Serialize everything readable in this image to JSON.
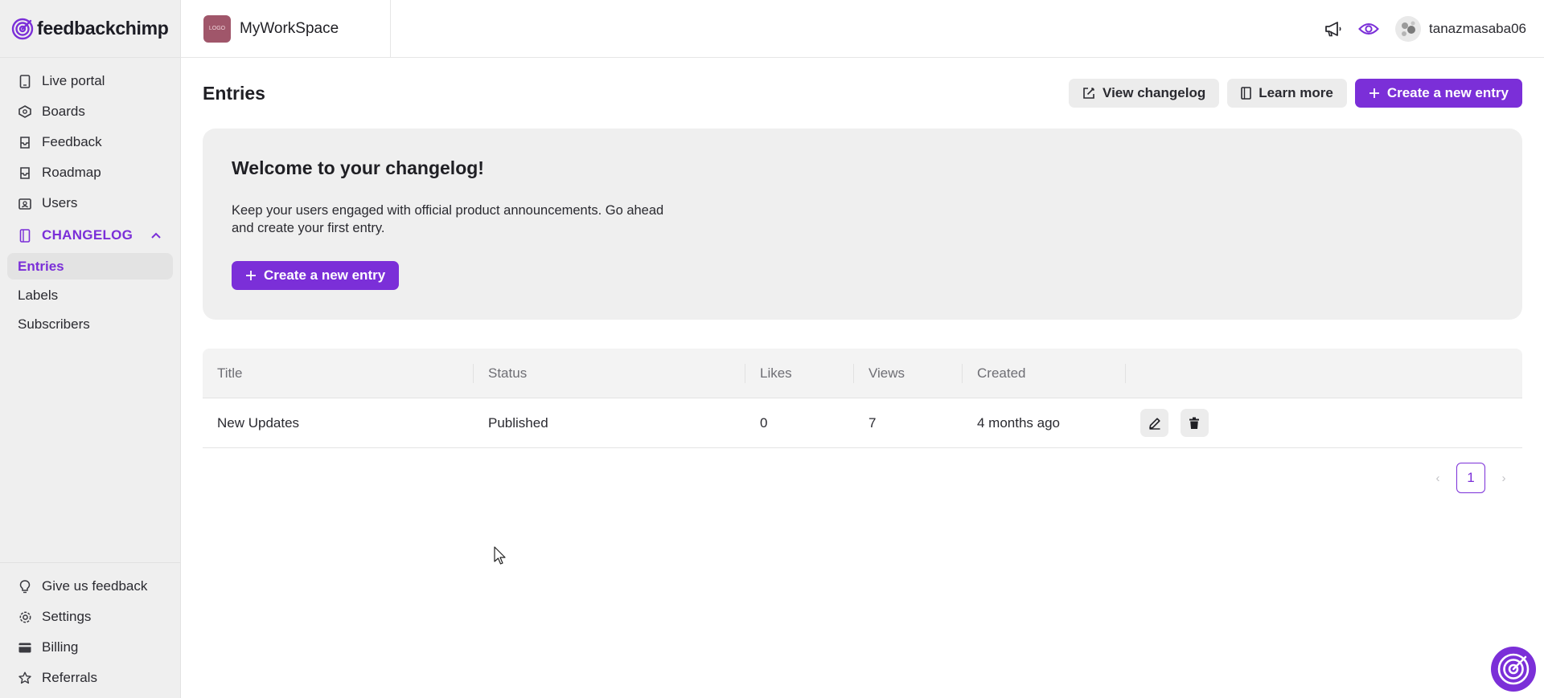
{
  "brand": {
    "name": "feedbackchimp"
  },
  "workspace": {
    "name": "MyWorkSpace",
    "logo_text": "LOGO"
  },
  "user": {
    "name": "tanazmasaba06"
  },
  "sidebar": {
    "items": [
      {
        "label": "Live portal",
        "icon": "tablet-icon"
      },
      {
        "label": "Boards",
        "icon": "board-icon"
      },
      {
        "label": "Feedback",
        "icon": "inbox-icon"
      },
      {
        "label": "Roadmap",
        "icon": "roadmap-icon"
      },
      {
        "label": "Users",
        "icon": "users-icon"
      }
    ],
    "section": {
      "label": "CHANGELOG",
      "icon": "book-icon",
      "expanded": true
    },
    "sub_items": [
      {
        "label": "Entries",
        "active": true
      },
      {
        "label": "Labels",
        "active": false
      },
      {
        "label": "Subscribers",
        "active": false
      }
    ],
    "bottom_items": [
      {
        "label": "Give us feedback",
        "icon": "lightbulb-icon"
      },
      {
        "label": "Settings",
        "icon": "gear-icon"
      },
      {
        "label": "Billing",
        "icon": "card-icon"
      },
      {
        "label": "Referrals",
        "icon": "star-icon"
      }
    ]
  },
  "page": {
    "title": "Entries",
    "actions": {
      "view_changelog": "View changelog",
      "learn_more": "Learn more",
      "create_entry": "Create a new entry"
    }
  },
  "welcome": {
    "title": "Welcome to your changelog!",
    "body": "Keep your users engaged with official product announcements. Go ahead and create your first entry.",
    "button": "Create a new entry"
  },
  "table": {
    "columns": [
      "Title",
      "Status",
      "Likes",
      "Views",
      "Created"
    ],
    "rows": [
      {
        "title": "New Updates",
        "status": "Published",
        "likes": "0",
        "views": "7",
        "created": "4 months ago"
      }
    ]
  },
  "pagination": {
    "current": "1",
    "prev": "‹",
    "next": "›"
  },
  "colors": {
    "accent": "#7b2fd8",
    "sidebar_bg": "#efefef"
  }
}
